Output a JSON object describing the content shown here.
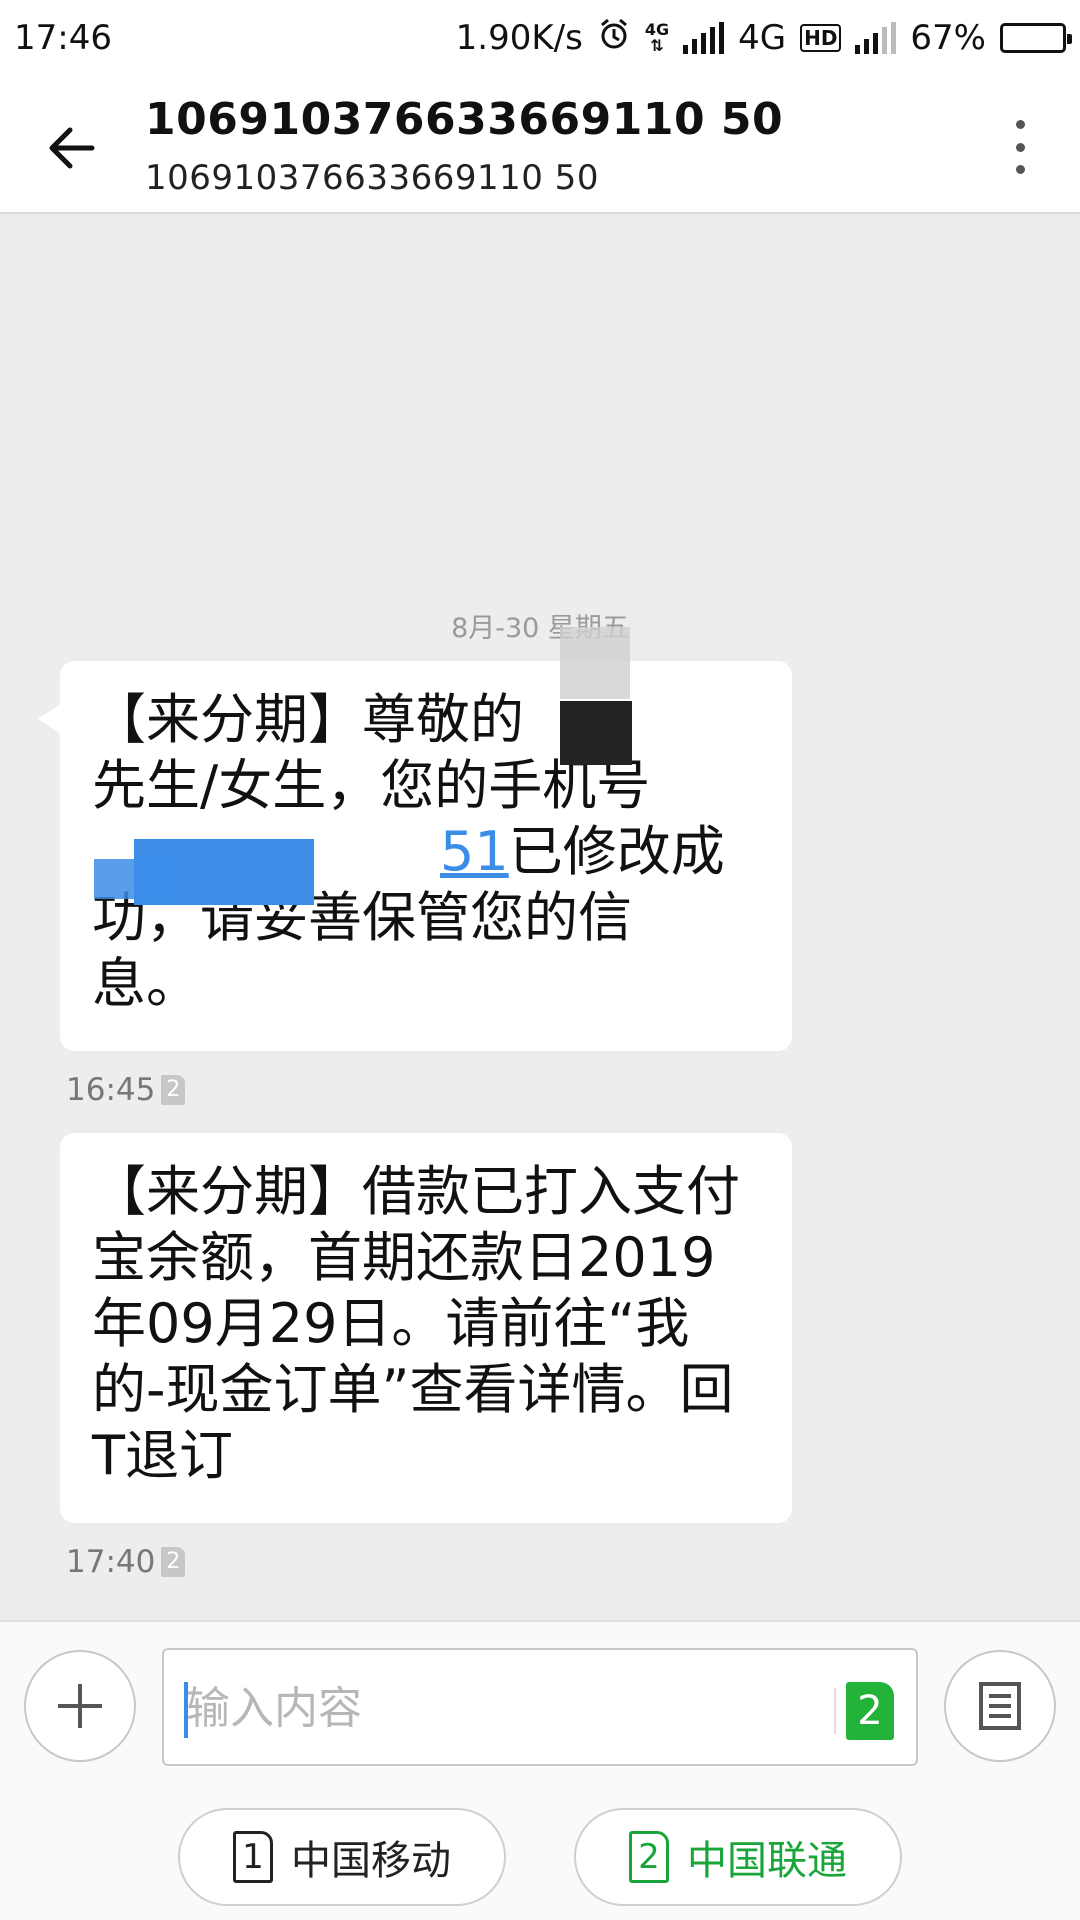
{
  "status_bar": {
    "time": "17:46",
    "network_speed": "1.90K/s",
    "net_type_small": "4G",
    "net_type": "4G",
    "hd_label": "HD",
    "battery_percent": "67%",
    "battery_level": 0.67
  },
  "header": {
    "title": "106910376633669110 50",
    "subtitle": "106910376633669110 50"
  },
  "conversation": {
    "date_label": "8月-30 星期五",
    "messages": [
      {
        "text": "【来分期】尊敬的[REDACTED]先生/女生，您的手机号[REDACTED]已修改成功，请妥善保管您的信息。",
        "text_before": "【来分期】尊敬的",
        "text_mid1": "先生/女生，您的手机号",
        "link_tail": "51",
        "text_mid2": "已修改成",
        "text_mid3": "功，请妥善保管您的信",
        "text_end": "息。",
        "time": "16:45",
        "sim": "2"
      },
      {
        "text": "【来分期】借款已打入支付宝余额，首期还款日2019年09月29日。请前往“我的-现金订单”查看详情。回T退订",
        "time": "17:40",
        "sim": "2"
      }
    ]
  },
  "composer": {
    "placeholder": "输入内容",
    "sim_send": "2",
    "sim1": {
      "index": "1",
      "label": "中国移动"
    },
    "sim2": {
      "index": "2",
      "label": "中国联通"
    }
  },
  "colors": {
    "accent_blue": "#3b8de8",
    "sim_green": "#23b23a"
  }
}
